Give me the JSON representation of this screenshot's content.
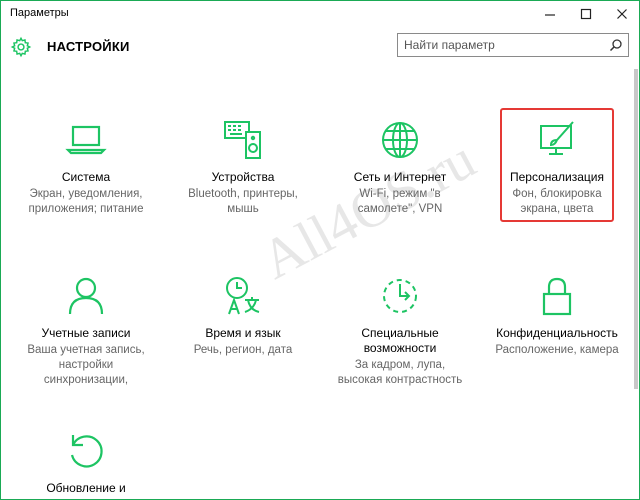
{
  "window": {
    "title": "Параметры",
    "controls": {
      "minimize": "—",
      "maximize": "☐",
      "close": "✕"
    }
  },
  "header": {
    "title": "НАСТРОЙКИ",
    "search_placeholder": "Найти параметр"
  },
  "tiles": [
    {
      "icon": "laptop-icon",
      "title": "Система",
      "desc": [
        "Экран, уведомления,",
        "приложения; питание"
      ]
    },
    {
      "icon": "devices-icon",
      "title": "Устройства",
      "desc": [
        "Bluetooth, принтеры,",
        "мышь"
      ]
    },
    {
      "icon": "globe-icon",
      "title": "Сеть и Интернет",
      "desc": [
        "Wi-Fi, режим \"в",
        "самолете\", VPN"
      ]
    },
    {
      "icon": "personalization-icon",
      "title": "Персонализация",
      "desc": [
        "Фон, блокировка",
        "экрана, цвета"
      ]
    },
    {
      "icon": "person-icon",
      "title": "Учетные записи",
      "desc": [
        "Ваша учетная запись,",
        "настройки",
        "синхронизации,"
      ]
    },
    {
      "icon": "time-language-icon",
      "title": "Время и язык",
      "desc": [
        "Речь, регион, дата"
      ]
    },
    {
      "icon": "accessibility-icon",
      "title": "Специальные\nвозможности",
      "desc": [
        "За кадром, лупа,",
        "высокая контрастность"
      ]
    },
    {
      "icon": "lock-icon",
      "title": "Конфиденциальность",
      "desc": [
        "Расположение, камера"
      ]
    },
    {
      "icon": "update-icon",
      "title": "Обновление и",
      "desc": []
    }
  ],
  "watermark": "All4OS.ru",
  "colors": {
    "accent": "#1dc463",
    "highlight": "#e53935",
    "border": "#1aaa55"
  }
}
